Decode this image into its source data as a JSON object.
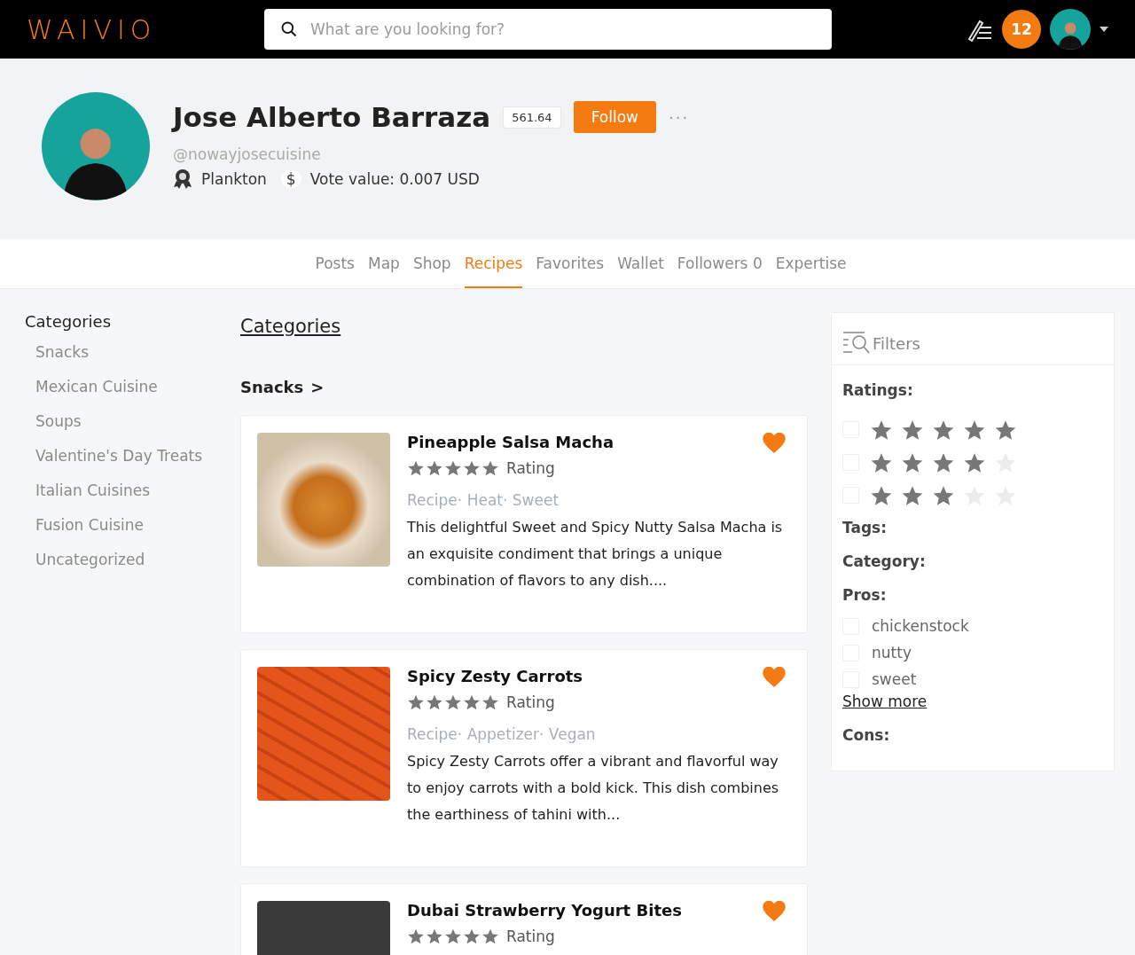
{
  "header": {
    "logo": "WAIVIO",
    "search": {
      "placeholder": "What are you looking for?"
    },
    "notifications": "12"
  },
  "profile": {
    "name": "Jose Alberto Barraza",
    "reputation": "561.64",
    "follow_button": "Follow",
    "more": "···",
    "handle": "@nowayjosecuisine",
    "rank": "Plankton",
    "currency_symbol": "$",
    "vote_value": "Vote value: 0.007 USD"
  },
  "tabs": [
    {
      "label": "Posts",
      "selected": false
    },
    {
      "label": "Map",
      "selected": false
    },
    {
      "label": "Shop",
      "selected": false
    },
    {
      "label": "Recipes",
      "selected": true
    },
    {
      "label": "Favorites",
      "selected": false
    },
    {
      "label": "Wallet",
      "selected": false
    },
    {
      "label": "Followers 0",
      "selected": false
    },
    {
      "label": "Expertise",
      "selected": false
    }
  ],
  "sidebar": {
    "title": "Categories",
    "items": [
      "Snacks",
      "Mexican Cuisine",
      "Soups",
      "Valentine's Day Treats",
      "Italian Cuisines",
      "Fusion Cuisine",
      "Uncategorized"
    ]
  },
  "main": {
    "heading": "Categories",
    "section": "Snacks",
    "section_arrow": ">",
    "recipes": [
      {
        "title": "Pineapple Salsa Macha",
        "stars": 5,
        "rating_label": "Rating",
        "tags": "Recipe· Heat· Sweet",
        "description": "This delightful Sweet and Spicy Nutty Salsa Macha is an exquisite condiment that brings a unique combination of flavors to any dish....",
        "favorite": true
      },
      {
        "title": "Spicy Zesty Carrots",
        "stars": 5,
        "rating_label": "Rating",
        "tags": "Recipe· Appetizer· Vegan",
        "description": "Spicy Zesty Carrots offer a vibrant and flavorful way to enjoy carrots with a bold kick. This dish combines the earthiness of tahini with...",
        "favorite": true
      },
      {
        "title": "Dubai Strawberry Yogurt Bites",
        "stars": 5,
        "rating_label": "Rating",
        "favorite": true
      }
    ]
  },
  "filters": {
    "title": "Filters",
    "ratings_label": "Ratings:",
    "ratings": [
      {
        "stars": 5,
        "checked": false
      },
      {
        "stars": 4,
        "checked": false
      },
      {
        "stars": 3,
        "checked": false
      }
    ],
    "tags_label": "Tags:",
    "category_label": "Category:",
    "pros_label": "Pros:",
    "pros": [
      {
        "label": "chickenstock",
        "checked": false
      },
      {
        "label": "nutty",
        "checked": false
      },
      {
        "label": "sweet",
        "checked": false
      }
    ],
    "show_more": "Show more",
    "cons_label": "Cons:"
  }
}
